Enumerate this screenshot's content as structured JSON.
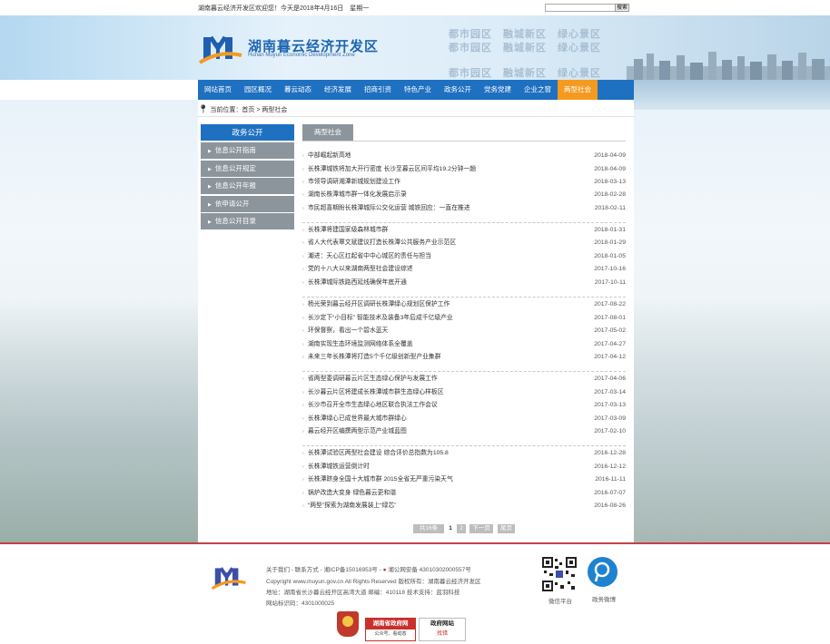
{
  "topbar": {
    "welcome": "湖南暮云经济开发区欢迎您！今天是2018年4月16日　星期一",
    "search_placeholder": "",
    "search_button": "搜索"
  },
  "header": {
    "name_cn": "湖南暮云经济开发区",
    "name_en": "Hunan Muyun Economic Development Zone",
    "slogans": [
      "都市园区　融城新区　绿心景区",
      "都市园区　融城新区　绿心景区",
      "都市园区　融城新区　绿心景区"
    ]
  },
  "nav": {
    "items": [
      "网站首页",
      "园区概况",
      "暮云动态",
      "经济发展",
      "招商引资",
      "特色产业",
      "政务公开",
      "党务党建",
      "企业之窗",
      "两型社会"
    ],
    "active": "两型社会"
  },
  "breadcrumb": "当前位置：首页 > 两型社会",
  "sidebar": {
    "title": "政务公开",
    "items": [
      "信息公开指南",
      "信息公开规定",
      "信息公开年报",
      "依申请公开",
      "信息公开目录"
    ]
  },
  "tab": "两型社会",
  "articles": [
    {
      "title": "中部崛起新高地",
      "date": "2018-04-09"
    },
    {
      "title": "长株潭城铁将加大开行密度 长沙至暮云区间平均19.2分钟一趟",
      "date": "2018-04-09"
    },
    {
      "title": "市领导调研湘潭新城规划建设工作",
      "date": "2018-03-13"
    },
    {
      "title": "湖南长株潭城市群一体化发展启示录",
      "date": "2018-02-28"
    },
    {
      "title": "市民超喜期盼长株潭城际公交化运营 城铁回应：一直在推进",
      "date": "2018-02-11"
    },
    {
      "title": "长株潭将建国家级森林城市群",
      "date": "2018-01-31"
    },
    {
      "title": "省人大代表覃文斌建议打造长株潭公共服务产业示范区",
      "date": "2018-01-29"
    },
    {
      "title": "潮进：天心区扛起省中中心城区的责任与担当",
      "date": "2018-01-05"
    },
    {
      "title": "党的十八大以来湖南两型社会建设综述",
      "date": "2017-10-16"
    },
    {
      "title": "长株潭城际铁路西延线确保年底开通",
      "date": "2017-10-11"
    },
    {
      "title": "杨光荣到暮云经开区调研长株潭绿心规划区保护工作",
      "date": "2017-08-22"
    },
    {
      "title": "长沙定下“小目标” 智能技术及装备3年后成千亿级产业",
      "date": "2017-08-01"
    },
    {
      "title": "环保督察，看出一个碧水蓝天",
      "date": "2017-05-02"
    },
    {
      "title": "湖南实现生态环境监测网络体系全覆盖",
      "date": "2017-04-27"
    },
    {
      "title": "未来三年长株潭将打造5个千亿级创新型产业集群",
      "date": "2017-04-12"
    },
    {
      "title": "省两型委调研暮云片区生态绿心保护与发展工作",
      "date": "2017-04-06"
    },
    {
      "title": "长沙暮云片区将建成长株潭城市群生态绿心样板区",
      "date": "2017-03-14"
    },
    {
      "title": "长沙市召开全市生态绿心地区联合执法工作会议",
      "date": "2017-03-13"
    },
    {
      "title": "长株潭绿心已成世界最大城市群绿心",
      "date": "2017-03-09"
    },
    {
      "title": "暮云经开区编撰两型示范产业城蓝图",
      "date": "2017-02-10"
    },
    {
      "title": "长株潭试验区两型社会建设 综合评价总指数为105.8",
      "date": "2016-12-28"
    },
    {
      "title": "长株潭城铁运营倒计时",
      "date": "2016-12-12"
    },
    {
      "title": "长株潭跻身全国十大城市群 2015全省无严重污染天气",
      "date": "2016-11-11"
    },
    {
      "title": "锅炉改造大变身 绿色暮云更和谐",
      "date": "2016-07-07"
    },
    {
      "title": "“两型”探索为湖南发展装上“绿芯”",
      "date": "2016-08-26"
    }
  ],
  "pager": {
    "total_label": "共16条",
    "current": "1",
    "page2": "2",
    "next": "下一页",
    "last": "尾页"
  },
  "footer": {
    "links": "关于我们 - 联系方式 - 湘ICP备15016953号 -",
    "police": "湘公网安备 43010302000557号",
    "copyright": "Copyright www.muyun.gov.cn All Rights Reserved  版权所有：湖南暮云经济开发区",
    "address": "地址：湖南省长沙暮云经开区高湾大道  邮编：410118  技术支持：蓝羽科技",
    "site_code": "网站标识码：4301000025",
    "qr_caption": "微信平台",
    "weibo_caption": "政务微博",
    "badge_gov": "湖南省政府网",
    "badge_gov_sub": "公众号、看动态",
    "badge_error": "政府网站",
    "badge_error_sub": "找错"
  },
  "colors": {
    "nav_blue": "#1e70c1",
    "nav_active": "#f49a1f",
    "sidebar_gray": "#8d959c",
    "footer_red": "#c94040"
  }
}
